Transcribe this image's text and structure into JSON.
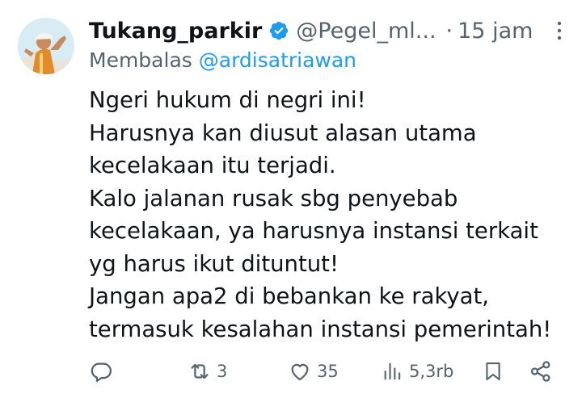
{
  "author": {
    "display_name": "Tukang_parkir",
    "handle": "@Pegel_ml...",
    "separator": "·",
    "time": "15 jam",
    "verified": true,
    "avatar_icon": "person-waving-avatar",
    "verified_color": "#1d9bf0"
  },
  "reply_to": {
    "prefix": "Membalas",
    "mention": "@ardisatriawan"
  },
  "tweet": {
    "lines": [
      "Ngeri hukum di negri ini!",
      "Harusnya kan diusut alasan utama",
      "kecelakaan itu terjadi.",
      "Kalo jalanan rusak sbg penyebab",
      "kecelakaan, ya harusnya instansi terkait",
      "yg harus ikut dituntut!",
      "Jangan apa2 di bebankan ke rakyat,",
      "termasuk kesalahan instansi pemerintah!"
    ]
  },
  "actions": {
    "reply_icon": "reply-icon",
    "retweet_icon": "retweet-icon",
    "retweet_count": "3",
    "like_icon": "heart-icon",
    "like_count": "35",
    "views_icon": "views-icon",
    "views_count": "5,3rb",
    "bookmark_icon": "bookmark-icon",
    "share_icon": "share-icon"
  },
  "colors": {
    "text": "#0f1419",
    "secondary": "#536471",
    "accent": "#1d9bf0"
  }
}
